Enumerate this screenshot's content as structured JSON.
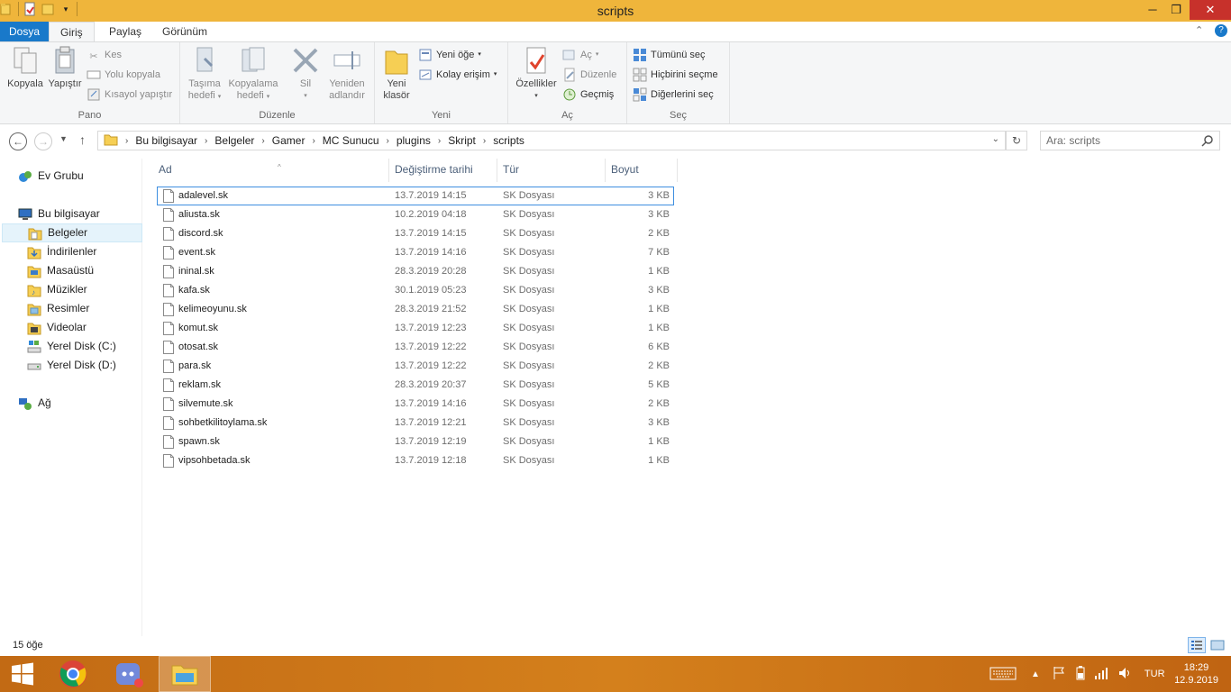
{
  "window": {
    "title": "scripts"
  },
  "ribbon_tabs": {
    "file": "Dosya",
    "home": "Giriş",
    "share": "Paylaş",
    "view": "Görünüm"
  },
  "ribbon": {
    "clipboard": {
      "label": "Pano",
      "copy": "Kopyala",
      "paste": "Yapıştır",
      "cut": "Kes",
      "copy_path": "Yolu kopyala",
      "paste_shortcut": "Kısayol yapıştır"
    },
    "organize": {
      "label": "Düzenle",
      "move_to_1": "Taşıma",
      "move_to_2": "hedefi",
      "copy_to_1": "Kopyalama",
      "copy_to_2": "hedefi",
      "delete": "Sil",
      "rename_1": "Yeniden",
      "rename_2": "adlandır"
    },
    "new": {
      "label": "Yeni",
      "new_folder_1": "Yeni",
      "new_folder_2": "klasör",
      "new_item": "Yeni öğe",
      "easy_access": "Kolay erişim"
    },
    "open": {
      "label": "Aç",
      "properties": "Özellikler",
      "open": "Aç",
      "edit": "Düzenle",
      "history": "Geçmiş"
    },
    "select": {
      "label": "Seç",
      "select_all": "Tümünü seç",
      "select_none": "Hiçbirini seçme",
      "invert": "Diğerlerini seç"
    }
  },
  "address": {
    "breadcrumbs": [
      "Bu bilgisayar",
      "Belgeler",
      "Gamer",
      "MC Sunucu",
      "plugins",
      "Skript",
      "scripts"
    ],
    "search_placeholder": "Ara: scripts"
  },
  "nav_pane": {
    "homegroup": "Ev Grubu",
    "this_pc": "Bu bilgisayar",
    "items": [
      "Belgeler",
      "İndirilenler",
      "Masaüstü",
      "Müzikler",
      "Resimler",
      "Videolar",
      "Yerel Disk (C:)",
      "Yerel Disk (D:)"
    ],
    "network": "Ağ"
  },
  "columns": {
    "name": "Ad",
    "date": "Değiştirme tarihi",
    "type": "Tür",
    "size": "Boyut"
  },
  "files": [
    {
      "name": "adalevel.sk",
      "date": "13.7.2019 14:15",
      "type": "SK Dosyası",
      "size": "3 KB"
    },
    {
      "name": "aliusta.sk",
      "date": "10.2.2019 04:18",
      "type": "SK Dosyası",
      "size": "3 KB"
    },
    {
      "name": "discord.sk",
      "date": "13.7.2019 14:15",
      "type": "SK Dosyası",
      "size": "2 KB"
    },
    {
      "name": "event.sk",
      "date": "13.7.2019 14:16",
      "type": "SK Dosyası",
      "size": "7 KB"
    },
    {
      "name": "ininal.sk",
      "date": "28.3.2019 20:28",
      "type": "SK Dosyası",
      "size": "1 KB"
    },
    {
      "name": "kafa.sk",
      "date": "30.1.2019 05:23",
      "type": "SK Dosyası",
      "size": "3 KB"
    },
    {
      "name": "kelimeoyunu.sk",
      "date": "28.3.2019 21:52",
      "type": "SK Dosyası",
      "size": "1 KB"
    },
    {
      "name": "komut.sk",
      "date": "13.7.2019 12:23",
      "type": "SK Dosyası",
      "size": "1 KB"
    },
    {
      "name": "otosat.sk",
      "date": "13.7.2019 12:22",
      "type": "SK Dosyası",
      "size": "6 KB"
    },
    {
      "name": "para.sk",
      "date": "13.7.2019 12:22",
      "type": "SK Dosyası",
      "size": "2 KB"
    },
    {
      "name": "reklam.sk",
      "date": "28.3.2019 20:37",
      "type": "SK Dosyası",
      "size": "5 KB"
    },
    {
      "name": "silvemute.sk",
      "date": "13.7.2019 14:16",
      "type": "SK Dosyası",
      "size": "2 KB"
    },
    {
      "name": "sohbetkilitoylama.sk",
      "date": "13.7.2019 12:21",
      "type": "SK Dosyası",
      "size": "3 KB"
    },
    {
      "name": "spawn.sk",
      "date": "13.7.2019 12:19",
      "type": "SK Dosyası",
      "size": "1 KB"
    },
    {
      "name": "vipsohbetada.sk",
      "date": "13.7.2019 12:18",
      "type": "SK Dosyası",
      "size": "1 KB"
    }
  ],
  "status": {
    "count": "15 öğe"
  },
  "taskbar": {
    "lang": "TUR",
    "time": "18:29",
    "date": "12.9.2019"
  },
  "colors": {
    "titlebar": "#efb53b",
    "file_tab": "#1979ca",
    "close": "#c7312b",
    "selection": "#3d8ee0",
    "taskbar": "#c8701a"
  }
}
